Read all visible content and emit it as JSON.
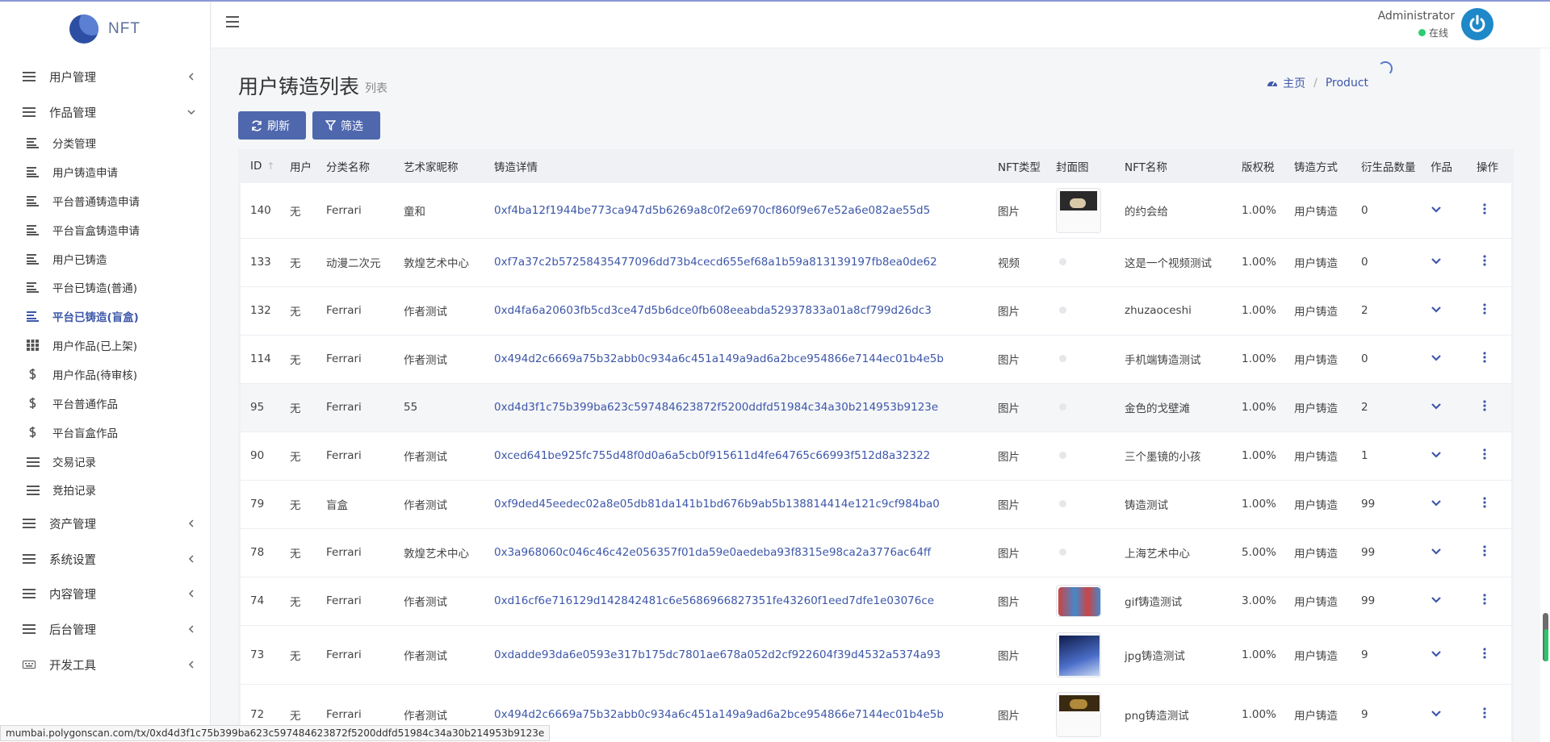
{
  "brand": {
    "name": "NFT"
  },
  "header": {
    "user_name": "Administrator",
    "status_text": "在线"
  },
  "page": {
    "title": "用户铸造列表",
    "subtitle": "列表"
  },
  "breadcrumb": {
    "home": "主页",
    "current": "Product"
  },
  "toolbar": {
    "refresh_label": "刷新",
    "filter_label": "筛选"
  },
  "sidebar": {
    "top_items": [
      {
        "label": "用户管理",
        "icon": "list-icon",
        "expanded": false
      },
      {
        "label": "作品管理",
        "icon": "list-icon",
        "expanded": true
      },
      {
        "label": "资产管理",
        "icon": "list-icon",
        "expanded": false
      },
      {
        "label": "系统设置",
        "icon": "list-icon",
        "expanded": false
      },
      {
        "label": "内容管理",
        "icon": "list-icon",
        "expanded": false
      },
      {
        "label": "后台管理",
        "icon": "list-icon",
        "expanded": false
      },
      {
        "label": "开发工具",
        "icon": "keyboard-icon",
        "expanded": false
      }
    ],
    "sub_items": [
      {
        "label": "分类管理",
        "icon": "align-left-icon"
      },
      {
        "label": "用户铸造申请",
        "icon": "align-left-icon"
      },
      {
        "label": "平台普通铸造申请",
        "icon": "align-left-icon"
      },
      {
        "label": "平台盲盒铸造申请",
        "icon": "align-left-icon"
      },
      {
        "label": "用户已铸造",
        "icon": "align-left-icon"
      },
      {
        "label": "平台已铸造(普通)",
        "icon": "align-left-icon"
      },
      {
        "label": "平台已铸造(盲盒)",
        "icon": "align-left-icon",
        "active": true
      },
      {
        "label": "用户作品(已上架)",
        "icon": "grid-icon"
      },
      {
        "label": "用户作品(待审核)",
        "icon": "dollar-icon"
      },
      {
        "label": "平台普通作品",
        "icon": "dollar-icon"
      },
      {
        "label": "平台盲盒作品",
        "icon": "dollar-icon"
      },
      {
        "label": "交易记录",
        "icon": "list-icon"
      },
      {
        "label": "竞拍记录",
        "icon": "list-icon"
      }
    ]
  },
  "table": {
    "columns": [
      "ID",
      "用户",
      "分类名称",
      "艺术家昵称",
      "铸造详情",
      "NFT类型",
      "封面图",
      "NFT名称",
      "版权税",
      "铸造方式",
      "衍生品数量",
      "作品",
      "操作"
    ],
    "rows": [
      {
        "id": "140",
        "user": "无",
        "category": "Ferrari",
        "artist": "童和",
        "hash": "0xf4ba12f1944be773ca947d5b6269a8c0f2e6970cf860f9e67e52a6e082ae55d5",
        "type": "图片",
        "cover": "image",
        "name": "的约会给",
        "royalty": "1.00%",
        "method": "用户铸造",
        "count": "0"
      },
      {
        "id": "133",
        "user": "无",
        "category": "动漫二次元",
        "artist": "敦煌艺术中心",
        "hash": "0xf7a37c2b57258435477096dd73b4cecd655ef68a1b59a813139197fb8ea0de62",
        "type": "视频",
        "cover": "none",
        "name": "这是一个视频测试",
        "royalty": "1.00%",
        "method": "用户铸造",
        "count": "0"
      },
      {
        "id": "132",
        "user": "无",
        "category": "Ferrari",
        "artist": "作者测试",
        "hash": "0xd4fa6a20603fb5cd3ce47d5b6dce0fb608eeabda52937833a01a8cf799d26dc3",
        "type": "图片",
        "cover": "none",
        "name": "zhuzaoceshi",
        "royalty": "1.00%",
        "method": "用户铸造",
        "count": "2"
      },
      {
        "id": "114",
        "user": "无",
        "category": "Ferrari",
        "artist": "作者测试",
        "hash": "0x494d2c6669a75b32abb0c934a6c451a149a9ad6a2bce954866e7144ec01b4e5b",
        "type": "图片",
        "cover": "none",
        "name": "手机端铸造测试",
        "royalty": "1.00%",
        "method": "用户铸造",
        "count": "0"
      },
      {
        "id": "95",
        "user": "无",
        "category": "Ferrari",
        "artist": "55",
        "hash": "0xd4d3f1c75b399ba623c597484623872f5200ddfd51984c34a30b214953b9123e",
        "type": "图片",
        "cover": "none",
        "name": "金色的戈壁滩",
        "royalty": "1.00%",
        "method": "用户铸造",
        "count": "2"
      },
      {
        "id": "90",
        "user": "无",
        "category": "Ferrari",
        "artist": "作者测试",
        "hash": "0xced641be925fc755d48f0d0a6a5cb0f915611d4fe64765c66993f512d8a32322",
        "type": "图片",
        "cover": "none",
        "name": "三个墨镜的小孩",
        "royalty": "1.00%",
        "method": "用户铸造",
        "count": "1"
      },
      {
        "id": "79",
        "user": "无",
        "category": "盲盒",
        "artist": "作者测试",
        "hash": "0xf9ded45eedec02a8e05db81da141b1bd676b9ab5b138814414e121c9cf984ba0",
        "type": "图片",
        "cover": "none",
        "name": "铸造测试",
        "royalty": "1.00%",
        "method": "用户铸造",
        "count": "99"
      },
      {
        "id": "78",
        "user": "无",
        "category": "Ferrari",
        "artist": "敦煌艺术中心",
        "hash": "0x3a968060c046c46c42e056357f01da59e0aedeba93f8315e98ca2a3776ac64ff",
        "type": "图片",
        "cover": "none",
        "name": "上海艺术中心",
        "royalty": "5.00%",
        "method": "用户铸造",
        "count": "99"
      },
      {
        "id": "74",
        "user": "无",
        "category": "Ferrari",
        "artist": "作者测试",
        "hash": "0xd16cf6e716129d142842481c6e5686966827351fe43260f1eed7dfe1e03076ce",
        "type": "图片",
        "cover": "image-small",
        "name": "gif铸造测试",
        "royalty": "3.00%",
        "method": "用户铸造",
        "count": "99"
      },
      {
        "id": "73",
        "user": "无",
        "category": "Ferrari",
        "artist": "作者测试",
        "hash": "0xdadde93da6e0593e317b175dc7801ae678a052d2cf922604f39d4532a5374a93",
        "type": "图片",
        "cover": "image",
        "name": "jpg铸造测试",
        "royalty": "1.00%",
        "method": "用户铸造",
        "count": "9"
      },
      {
        "id": "72",
        "user": "无",
        "category": "Ferrari",
        "artist": "作者测试",
        "hash": "0x494d2c6669a75b32abb0c934a6c451a149a9ad6a2bce954866e7144ec01b4e5b",
        "type": "图片",
        "cover": "image",
        "name": "png铸造测试",
        "royalty": "1.00%",
        "method": "用户铸造",
        "count": "9"
      }
    ]
  },
  "statusbar": {
    "url": "mumbai.polygonscan.com/tx/0xd4d3f1c75b399ba623c597484623872f5200ddfd51984c34a30b214953b9123e"
  },
  "colors": {
    "accent": "#4f67ad",
    "link": "#3d57a9",
    "online": "#2ecc71",
    "avatar": "#1e88c8"
  }
}
